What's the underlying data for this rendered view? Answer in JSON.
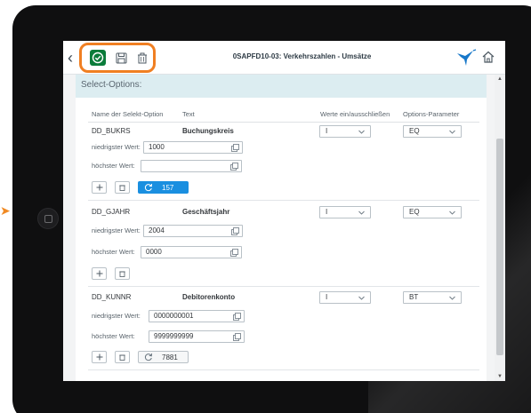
{
  "window": {
    "title": "0SAPFD10-03: Verkehrszahlen - Umsätze"
  },
  "toolbar": {
    "back_icon": "chevron-left-icon",
    "execute_icon": "check-circle-icon",
    "save_icon": "floppy-disk-icon",
    "delete_icon": "trash-icon",
    "logo_icon": "hummingbird-logo",
    "home_icon": "home-icon",
    "accent_color": "#0a7c3a",
    "highlight_color": "#f07f22"
  },
  "section": {
    "title": "Select-Options:"
  },
  "table": {
    "headers": {
      "name": "Name der Selekt-Option",
      "text": "Text",
      "include": "Werte ein/ausschließen",
      "option": "Options-Parameter"
    },
    "low_label": "niedrigster Wert:",
    "high_label": "höchster Wert:",
    "rows": [
      {
        "name": "DD_BUKRS",
        "text": "Buchungskreis",
        "include": "I",
        "option": "EQ",
        "low": "1000",
        "high": "",
        "count": "157",
        "count_active": true
      },
      {
        "name": "DD_GJAHR",
        "text": "Geschäftsjahr",
        "include": "I",
        "option": "EQ",
        "low": "2004",
        "high": "0000",
        "count": "",
        "count_active": false
      },
      {
        "name": "DD_KUNNR",
        "text": "Debitorenkonto",
        "include": "I",
        "option": "BT",
        "low": "0000000001",
        "high": "9999999999",
        "count": "7881",
        "count_active": false
      }
    ]
  },
  "colors": {
    "section_header_bg": "#dcedf1",
    "primary_button": "#1a8fe0"
  }
}
